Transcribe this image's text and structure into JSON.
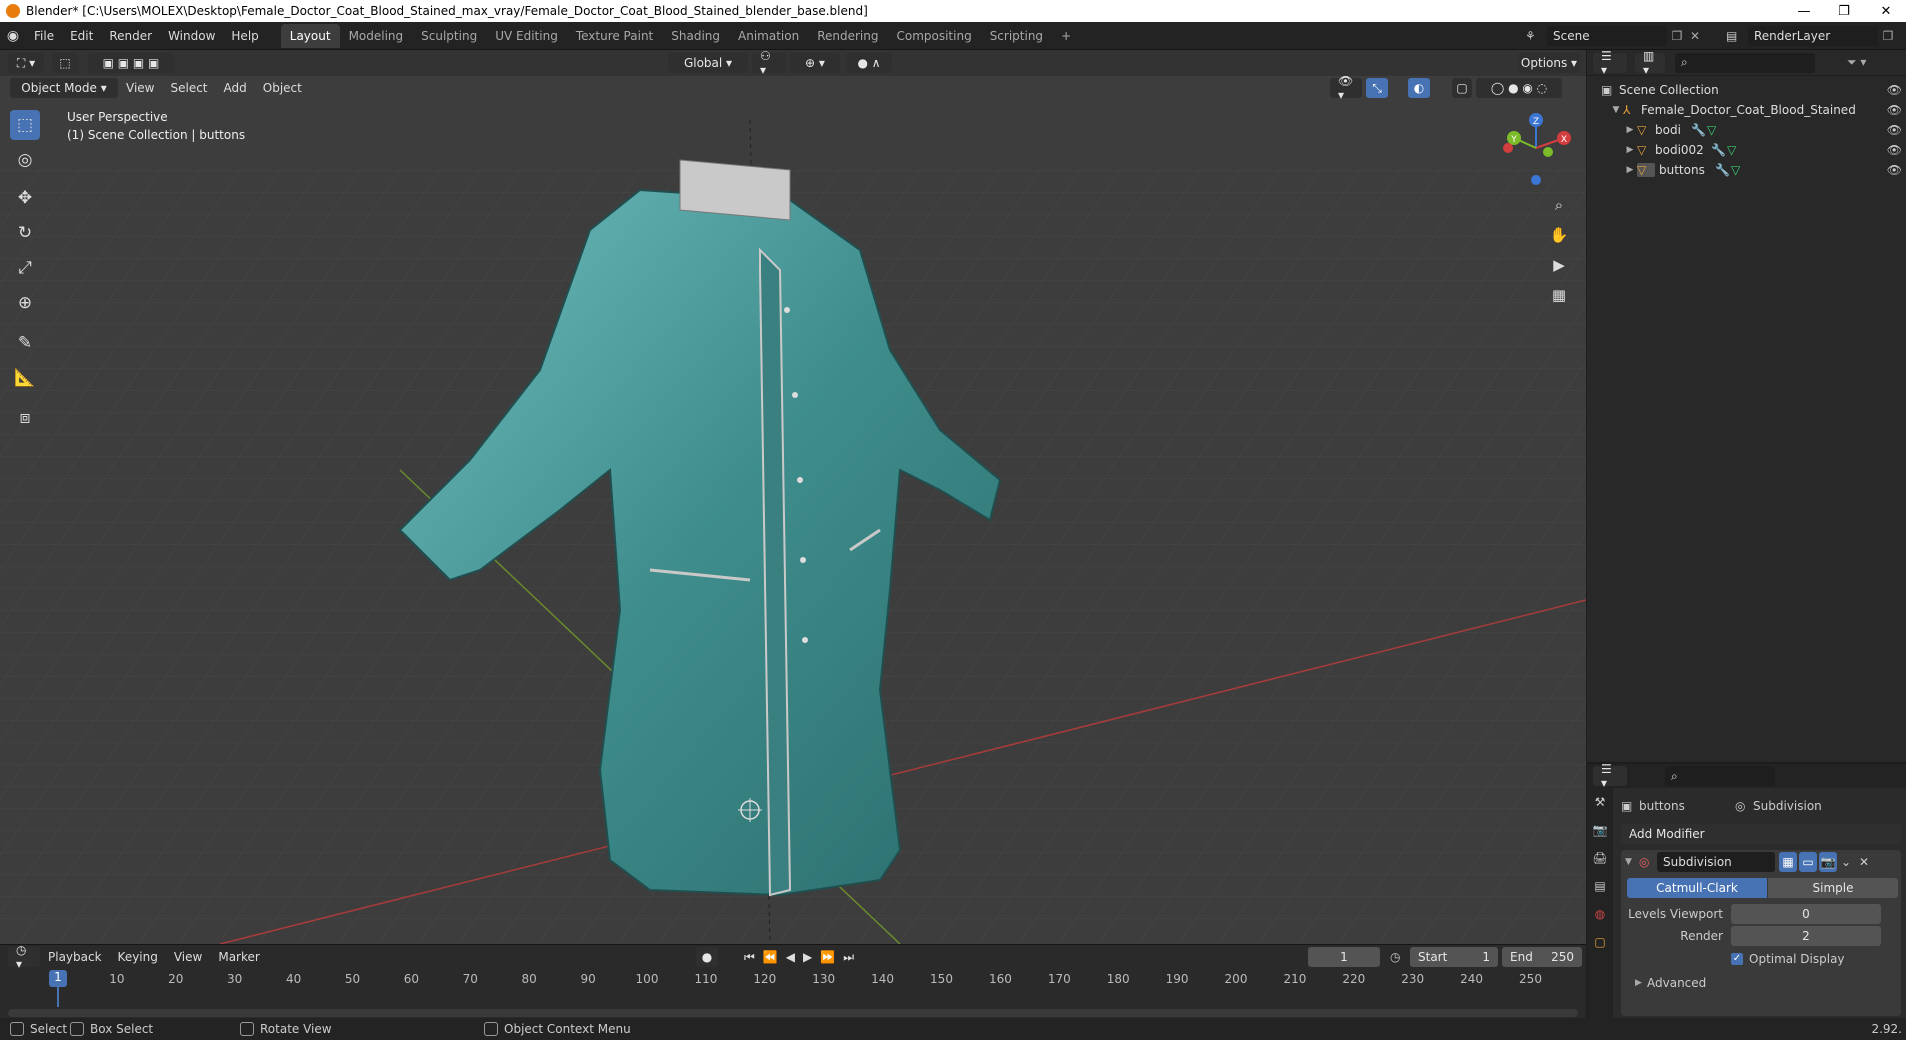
{
  "window": {
    "title": "Blender* [C:\\Users\\MOLEX\\Desktop\\Female_Doctor_Coat_Blood_Stained_max_vray/Female_Doctor_Coat_Blood_Stained_blender_base.blend]",
    "minimize": "—",
    "restore": "❐",
    "close": "✕"
  },
  "menus": [
    "File",
    "Edit",
    "Render",
    "Window",
    "Help"
  ],
  "workspaces": [
    "Layout",
    "Modeling",
    "Sculpting",
    "UV Editing",
    "Texture Paint",
    "Shading",
    "Animation",
    "Rendering",
    "Compositing",
    "Scripting"
  ],
  "active_workspace": "Layout",
  "add_workspace": "+",
  "scene": {
    "name": "Scene",
    "render_layer": "RenderLayer"
  },
  "viewport_header": {
    "transform_orientation": "Global",
    "options": "Options",
    "mode": "Object Mode",
    "menus": [
      "View",
      "Select",
      "Add",
      "Object"
    ]
  },
  "viewport": {
    "perspective": "User Perspective",
    "collection_info": "(1) Scene Collection | buttons",
    "gizmo": {
      "z": "Z",
      "y": "Y",
      "x": "X"
    }
  },
  "outliner": {
    "root": "Scene Collection",
    "collection": "Female_Doctor_Coat_Blood_Stained",
    "objects": [
      "bodi",
      "bodi002",
      "buttons"
    ]
  },
  "properties": {
    "object": "buttons",
    "modifier_name": "Subdivision",
    "add_modifier": "Add Modifier",
    "modifier_panel_name": "Subdivision",
    "types": [
      "Catmull-Clark",
      "Simple"
    ],
    "active_type": "Catmull-Clark",
    "levels_viewport_label": "Levels Viewport",
    "levels_viewport": "0",
    "render_label": "Render",
    "render": "2",
    "optimal_display": "Optimal Display",
    "advanced": "Advanced"
  },
  "timeline": {
    "menus": [
      "Playback",
      "Keying",
      "View",
      "Marker"
    ],
    "current_frame": "1",
    "start_label": "Start",
    "start": "1",
    "end_label": "End",
    "end": "250",
    "ticks": [
      "10",
      "20",
      "30",
      "40",
      "50",
      "60",
      "70",
      "80",
      "90",
      "100",
      "110",
      "120",
      "130",
      "140",
      "150",
      "160",
      "170",
      "180",
      "190",
      "200",
      "210",
      "220",
      "230",
      "240",
      "250"
    ],
    "playhead": "1"
  },
  "statusbar": {
    "select": "Select",
    "box_select": "Box Select",
    "rotate_view": "Rotate View",
    "context_menu": "Object Context Menu",
    "version": "2.92."
  }
}
